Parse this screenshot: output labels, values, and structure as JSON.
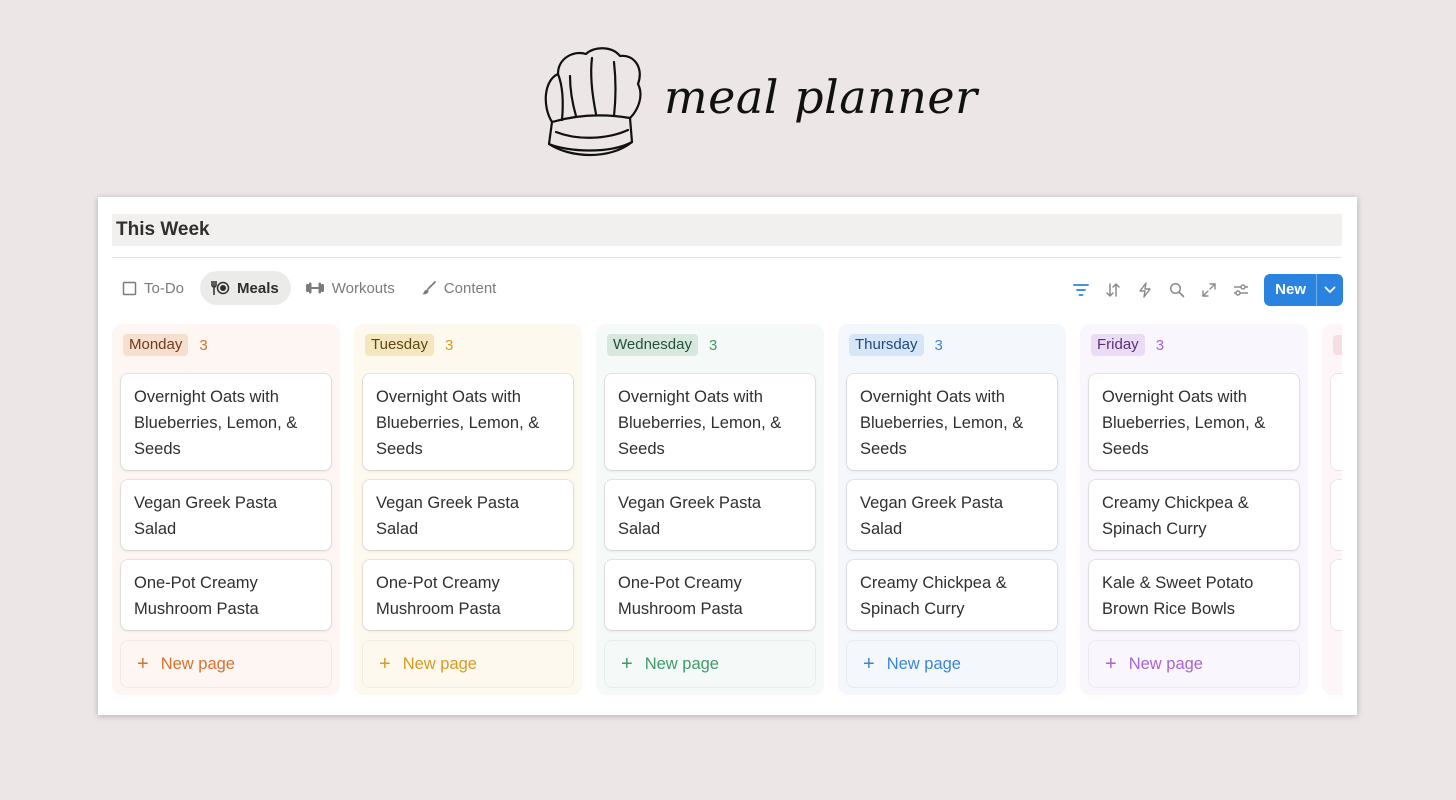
{
  "hero": {
    "title": "meal planner",
    "icon": "chef-hat-icon"
  },
  "panel": {
    "title": "This Week",
    "views": [
      {
        "label": "To-Do",
        "icon": "checkbox-icon",
        "active": false
      },
      {
        "label": "Meals",
        "icon": "utensils-icon",
        "active": true
      },
      {
        "label": "Workouts",
        "icon": "dumbbell-icon",
        "active": false
      },
      {
        "label": "Content",
        "icon": "brush-icon",
        "active": false
      }
    ],
    "tools": [
      "filter-icon",
      "sort-icon",
      "automation-icon",
      "search-icon",
      "expand-icon",
      "settings-icon"
    ],
    "new_button": {
      "label": "New"
    },
    "columns": [
      {
        "name": "Monday",
        "count": "3",
        "tag_bg": "#f7dfcf",
        "tag_fg": "#6e3a1a",
        "accent": "#d9722f",
        "col_bg": "#fdf6f2",
        "cards": [
          "Overnight Oats with Blueberries, Lemon, & Seeds",
          "Vegan Greek Pasta Salad",
          "One-Pot Creamy Mushroom Pasta"
        ],
        "new_page": "New page"
      },
      {
        "name": "Tuesday",
        "count": "3",
        "tag_bg": "#f4e6bf",
        "tag_fg": "#5e4615",
        "accent": "#d99a20",
        "col_bg": "#fdf9ef",
        "cards": [
          "Overnight Oats with Blueberries, Lemon, & Seeds",
          "Vegan Greek Pasta Salad",
          "One-Pot Creamy Mushroom Pasta"
        ],
        "new_page": "New page"
      },
      {
        "name": "Wednesday",
        "count": "3",
        "tag_bg": "#d8e8de",
        "tag_fg": "#24513a",
        "accent": "#3f9b68",
        "col_bg": "#f5f9f7",
        "cards": [
          "Overnight Oats with Blueberries, Lemon, & Seeds",
          "Vegan Greek Pasta Salad",
          "One-Pot Creamy Mushroom Pasta"
        ],
        "new_page": "New page"
      },
      {
        "name": "Thursday",
        "count": "3",
        "tag_bg": "#d6e6f8",
        "tag_fg": "#1f4a78",
        "accent": "#3a86d6",
        "col_bg": "#f4f8fd",
        "cards": [
          "Overnight Oats with Blueberries, Lemon, & Seeds",
          "Vegan Greek Pasta Salad",
          "Creamy Chickpea & Spinach Curry"
        ],
        "new_page": "New page"
      },
      {
        "name": "Friday",
        "count": "3",
        "tag_bg": "#eadcf5",
        "tag_fg": "#5a2f7a",
        "accent": "#a765d3",
        "col_bg": "#faf6fd",
        "cards": [
          "Overnight Oats with Blueberries, Lemon, & Seeds",
          "Creamy Chickpea & Spinach Curry",
          "Kale & Sweet Potato Brown Rice Bowls"
        ],
        "new_page": "New page"
      }
    ],
    "next_column_accent": "#f6dde3"
  }
}
